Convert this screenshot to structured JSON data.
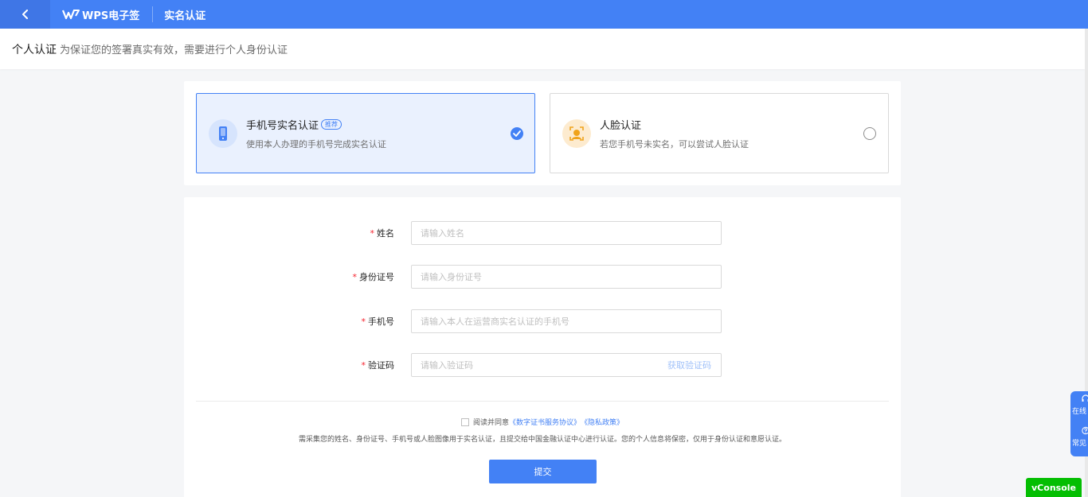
{
  "topbar": {
    "brand": "WPS电子签",
    "title": "实名认证"
  },
  "subheader": {
    "title": "个人认证",
    "description": "为保证您的签署真实有效，需要进行个人身份认证"
  },
  "methods": [
    {
      "title": "手机号实名认证",
      "badge": "推荐",
      "description": "使用本人办理的手机号完成实名认证",
      "selected": true,
      "icon": "phone-icon"
    },
    {
      "title": "人脸认证",
      "description": "若您手机号未实名，可以尝试人脸认证",
      "selected": false,
      "icon": "face-icon"
    }
  ],
  "form": {
    "name": {
      "label": "姓名",
      "placeholder": "请输入姓名"
    },
    "id_number": {
      "label": "身份证号",
      "placeholder": "请输入身份证号"
    },
    "phone": {
      "label": "手机号",
      "placeholder": "请输入本人在运营商实名认证的手机号"
    },
    "code": {
      "label": "验证码",
      "placeholder": "请输入验证码",
      "action": "获取验证码"
    },
    "required_mark": "*"
  },
  "agreement": {
    "prefix": "阅读并同意",
    "link1": "《数字证书服务协议》",
    "link2": "《隐私政策》",
    "notice": "需采集您的姓名、身份证号、手机号或人脸图像用于实名认证，且提交给中国金融认证中心进行认证。您的个人信息将保密，仅用于身份认证和意愿认证。"
  },
  "submit_label": "提交",
  "float_service": {
    "item1": "在线",
    "item2": "常见"
  },
  "vconsole": "vConsole",
  "colors": {
    "primary": "#4381f5",
    "required": "#f5222d",
    "vconsole": "#04be02"
  }
}
